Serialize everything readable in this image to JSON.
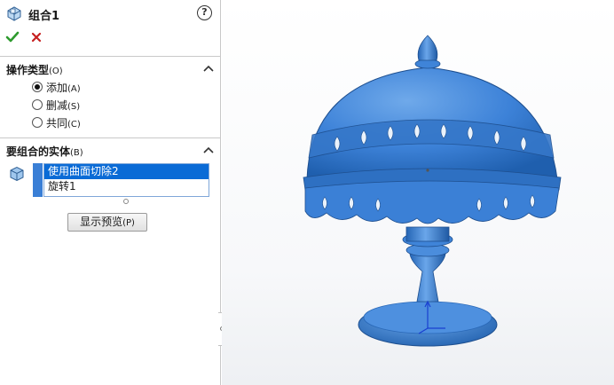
{
  "feature": {
    "title": "组合1",
    "help_glyph": "?"
  },
  "actions": {
    "ok_icon": "check-icon",
    "cancel_icon": "x-icon"
  },
  "operation_type": {
    "title": "操作类型",
    "hotkey": "(O)",
    "options": [
      {
        "label": "添加",
        "hotkey": "(A)",
        "selected": true
      },
      {
        "label": "删减",
        "hotkey": "(S)",
        "selected": false
      },
      {
        "label": "共同",
        "hotkey": "(C)",
        "selected": false
      }
    ]
  },
  "bodies": {
    "title": "要组合的实体",
    "hotkey": "(B)",
    "items": [
      {
        "label": "使用曲面切除2",
        "selected": true
      },
      {
        "label": "旋转1",
        "selected": false
      }
    ]
  },
  "preview_button": {
    "label": "显示预览",
    "hotkey": "(P)"
  },
  "colors": {
    "accent": "#0a6bd6",
    "model": "#3d82d8",
    "ok": "#2e9a2e",
    "cancel": "#c62020"
  }
}
